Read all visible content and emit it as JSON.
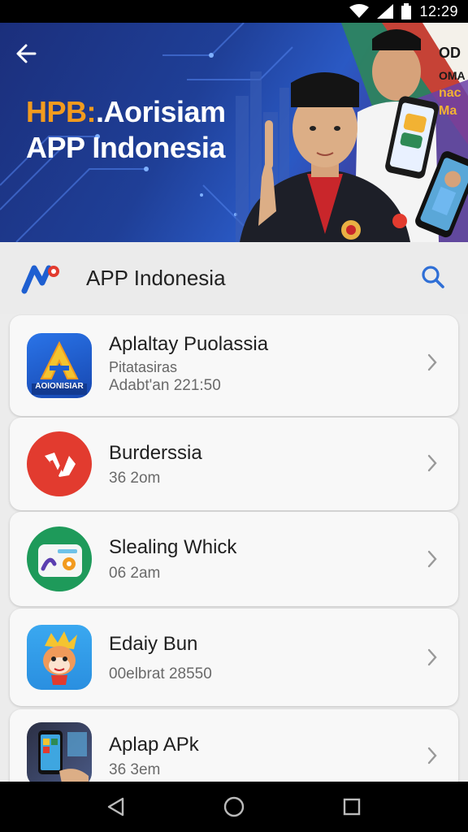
{
  "status_bar": {
    "time": "12:29",
    "icons": [
      "wifi-icon",
      "signal-icon",
      "battery-icon"
    ]
  },
  "hero": {
    "title_line1_accent": "HPB:",
    "title_line1_rest": ".Aorisiam",
    "title_line2": "APP Indonesia",
    "right_edge_text_1": "OD",
    "right_edge_text_2": "OMA",
    "right_edge_text_3": "nac",
    "right_edge_text_4": "Ma",
    "back_icon": "arrow-left-icon"
  },
  "header": {
    "title": "APP Indonesia",
    "search_icon": "search-icon",
    "accent": "#2f6fd6"
  },
  "apps": [
    {
      "name": "Aplaltay Puolassia",
      "sub": "Pitatasiras",
      "meta": "Adabt'an 221:50",
      "icon_label": "AOIONISIAR",
      "icon_color": "#1e5fd1"
    },
    {
      "name": "Burderssia",
      "meta": "36 2om",
      "icon_color": "#e23b2f"
    },
    {
      "name": "Slealing Whick",
      "meta": "06 2am",
      "icon_color": "#1e9a5a"
    },
    {
      "name": "Edaiy Bun",
      "meta": "00elbrat 28550",
      "icon_color": "#2f9fe8"
    },
    {
      "name": "Aplap APk",
      "meta": "36 3em",
      "icon_color": "#3a3f56"
    }
  ],
  "nav": {
    "back_icon": "triangle-back-icon",
    "home_icon": "circle-home-icon",
    "recents_icon": "square-recents-icon"
  }
}
